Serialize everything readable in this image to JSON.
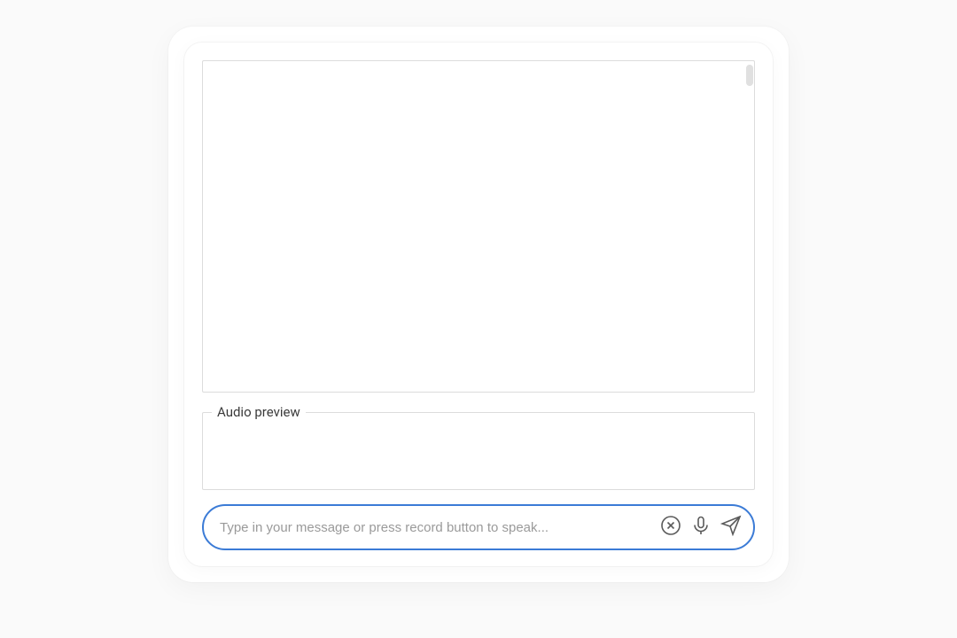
{
  "audio_preview": {
    "label": "Audio preview"
  },
  "input": {
    "placeholder": "Type in your message or press record button to speak...",
    "value": ""
  },
  "icons": {
    "close": "close-icon",
    "microphone": "microphone-icon",
    "send": "send-icon"
  }
}
